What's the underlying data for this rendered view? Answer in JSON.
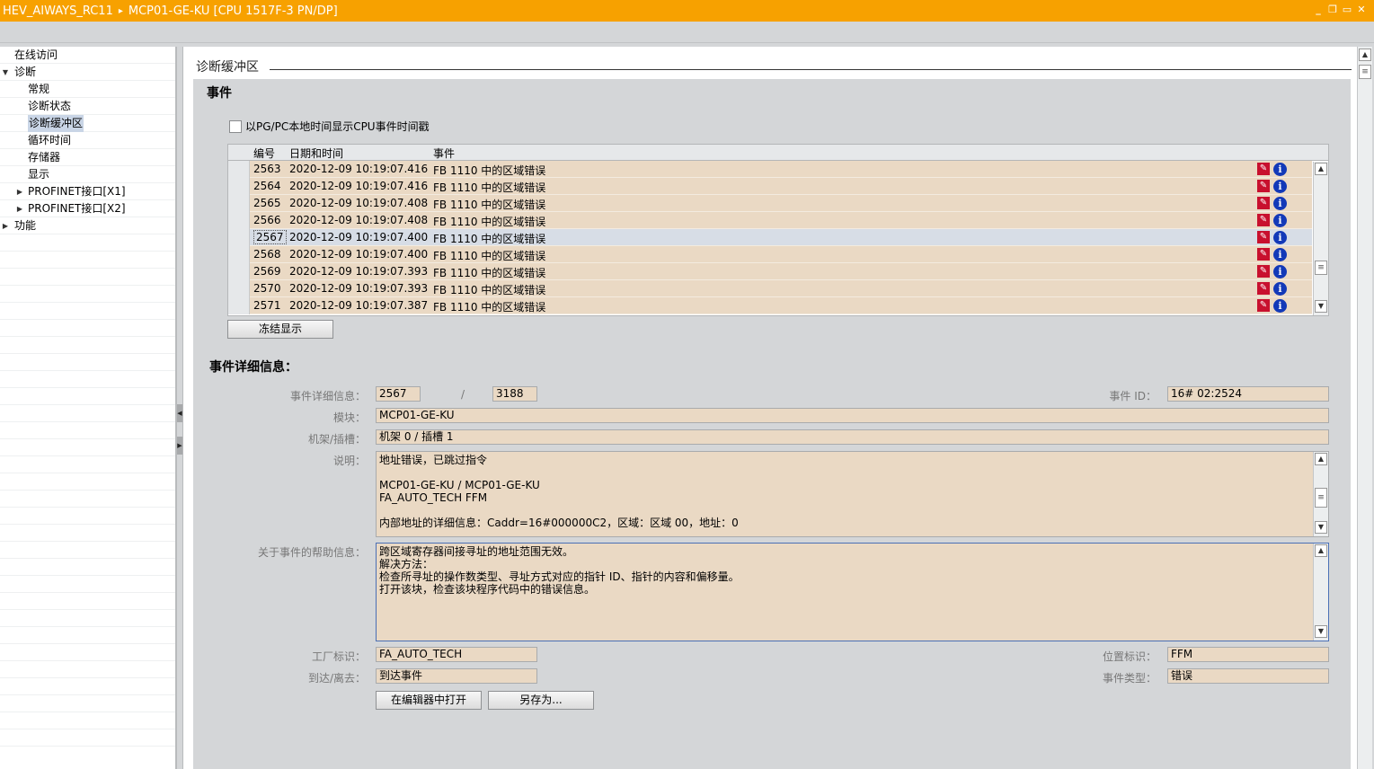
{
  "titlebar": {
    "project": "HEV_AIWAYS_RC11",
    "separator": "▸",
    "device": "MCP01-GE-KU [CPU 1517F-3 PN/DP]"
  },
  "tree": {
    "items": [
      {
        "label": "在线访问",
        "level": 0,
        "arrow": ""
      },
      {
        "label": "诊断",
        "level": 0,
        "arrow": "▼"
      },
      {
        "label": "常规",
        "level": 1,
        "arrow": ""
      },
      {
        "label": "诊断状态",
        "level": 1,
        "arrow": ""
      },
      {
        "label": "诊断缓冲区",
        "level": 1,
        "arrow": ""
      },
      {
        "label": "循环时间",
        "level": 1,
        "arrow": ""
      },
      {
        "label": "存储器",
        "level": 1,
        "arrow": ""
      },
      {
        "label": "显示",
        "level": 1,
        "arrow": ""
      },
      {
        "label": "PROFINET接口[X1]",
        "level": 1,
        "arrow": "▶"
      },
      {
        "label": "PROFINET接口[X2]",
        "level": 1,
        "arrow": "▶"
      },
      {
        "label": "功能",
        "level": 0,
        "arrow": "▶"
      }
    ]
  },
  "main": {
    "section_title": "诊断缓冲区",
    "events_title": "事件",
    "checkbox_label": "以PG/PC本地时间显示CPU事件时间戳",
    "table": {
      "headers": [
        "编号",
        "日期和时间",
        "事件"
      ],
      "rows": [
        {
          "num": "2563",
          "datetime": "2020-12-09 10:19:07.416",
          "event": "FB 1110 中的区域错误"
        },
        {
          "num": "2564",
          "datetime": "2020-12-09 10:19:07.416",
          "event": "FB 1110 中的区域错误"
        },
        {
          "num": "2565",
          "datetime": "2020-12-09 10:19:07.408",
          "event": "FB 1110 中的区域错误"
        },
        {
          "num": "2566",
          "datetime": "2020-12-09 10:19:07.408",
          "event": "FB 1110 中的区域错误"
        },
        {
          "num": "2567",
          "datetime": "2020-12-09 10:19:07.400",
          "event": "FB 1110 中的区域错误"
        },
        {
          "num": "2568",
          "datetime": "2020-12-09 10:19:07.400",
          "event": "FB 1110 中的区域错误"
        },
        {
          "num": "2569",
          "datetime": "2020-12-09 10:19:07.393",
          "event": "FB 1110 中的区域错误"
        },
        {
          "num": "2570",
          "datetime": "2020-12-09 10:19:07.393",
          "event": "FB 1110 中的区域错误"
        },
        {
          "num": "2571",
          "datetime": "2020-12-09 10:19:07.387",
          "event": "FB 1110 中的区域错误"
        }
      ],
      "error_glyph": "✎",
      "info_glyph": "i"
    },
    "freeze_button": "冻结显示",
    "details": {
      "title": "事件详细信息：",
      "detail_label": "事件详细信息：",
      "detail_value": "2567",
      "detail_slash": "/",
      "detail_total": "3188",
      "event_id_label": "事件 ID：",
      "event_id_value": "16# 02:2524",
      "module_label": "模块：",
      "module_value": "MCP01-GE-KU",
      "rack_label": "机架/插槽：",
      "rack_value": "机架 0 / 插槽 1",
      "desc_label": "说明：",
      "desc_lines": [
        "地址错误，已跳过指令",
        "",
        " MCP01-GE-KU / MCP01-GE-KU",
        "FA_AUTO_TECH FFM",
        "",
        "内部地址的详细信息：Caddr=16#000000C2，区域：区域 00，地址：0"
      ],
      "help_label": "关于事件的帮助信息：",
      "help_lines": [
        "跨区域寄存器间接寻址的地址范围无效。",
        "解决方法：",
        "检查所寻址的操作数类型、寻址方式对应的指针 ID、指针的内容和偏移量。",
        "打开该块，检查该块程序代码中的错误信息。"
      ],
      "plant_label": "工厂标识：",
      "plant_value": "FA_AUTO_TECH",
      "location_label": "位置标识：",
      "location_value": "FFM",
      "arrive_label": "到达/离去：",
      "arrive_value": "到达事件",
      "event_type_label": "事件类型：",
      "event_type_value": "错误",
      "open_editor_button": "在编辑器中打开",
      "save_as_button": "另存为..."
    }
  },
  "colors": {
    "title_orange": "#f7a100",
    "field_bg": "#ead9c4",
    "selected_row": "#d7dde6",
    "error_red": "#c8102e",
    "info_blue": "#1239b8"
  }
}
